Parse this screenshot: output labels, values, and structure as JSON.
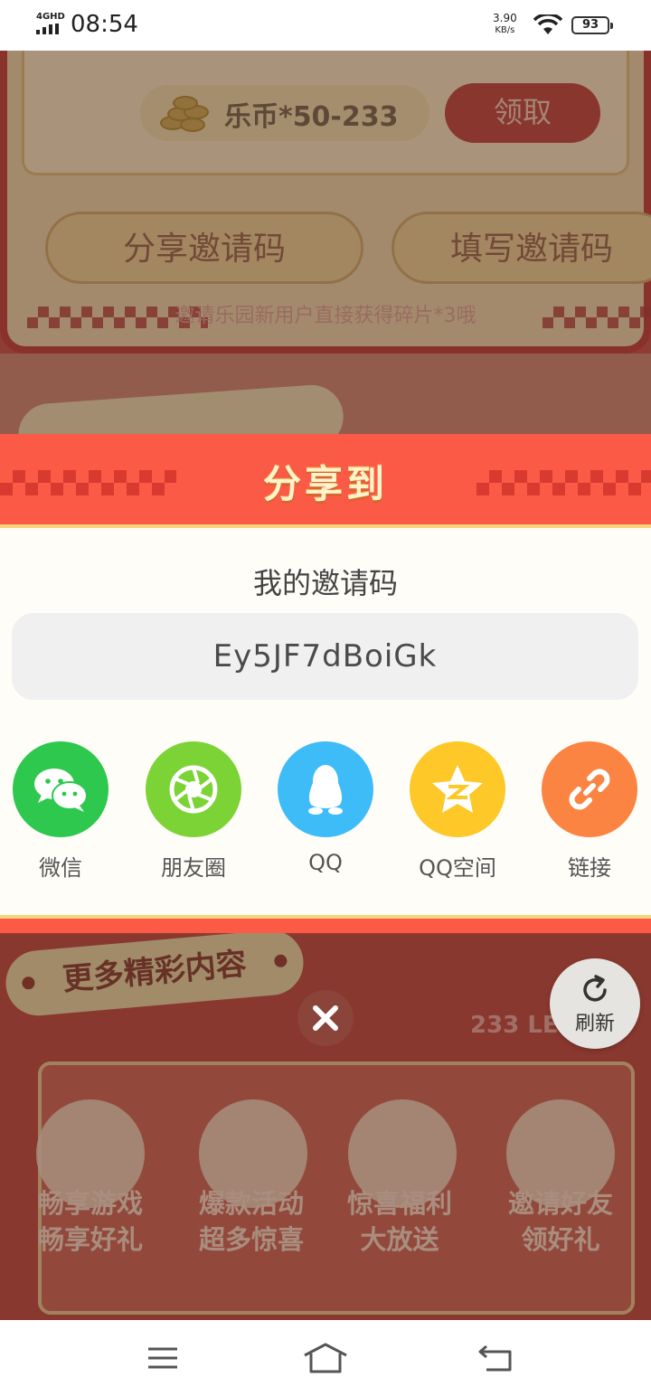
{
  "status_bar": {
    "network": "4GHD",
    "time": "08:54",
    "speed_value": "3.90",
    "speed_unit": "KB/s",
    "battery": "93"
  },
  "background": {
    "coin_label": "乐币*50-233",
    "claim_button": "领取",
    "share_code_button": "分享邀请码",
    "fill_code_button": "填写邀请码",
    "invite_note": "邀请乐园新用户直接获得碎片*3哦",
    "more_banner": "更多精彩内容",
    "brand_text": "233 LE",
    "features": [
      {
        "line1": "畅享游戏",
        "line2": "畅享好礼"
      },
      {
        "line1": "爆款活动",
        "line2": "超多惊喜"
      },
      {
        "line1": "惊喜福利",
        "line2": "大放送"
      },
      {
        "line1": "邀请好友",
        "line2": "领好礼"
      }
    ]
  },
  "share_sheet": {
    "title": "分享到",
    "code_label": "我的邀请码",
    "code_value": "Ey5JF7dBoiGk",
    "targets": [
      {
        "label": "微信",
        "icon": "wechat-icon",
        "color": "#2dc84d"
      },
      {
        "label": "朋友圈",
        "icon": "moments-icon",
        "color": "#7cd336"
      },
      {
        "label": "QQ",
        "icon": "qq-icon",
        "color": "#3ebcf8"
      },
      {
        "label": "QQ空间",
        "icon": "qzone-icon",
        "color": "#fdc828"
      },
      {
        "label": "链接",
        "icon": "link-icon",
        "color": "#fb8443"
      }
    ]
  },
  "refresh_label": "刷新",
  "colors": {
    "sheet_header": "#fb5a46",
    "title_text": "#fff3c8"
  }
}
